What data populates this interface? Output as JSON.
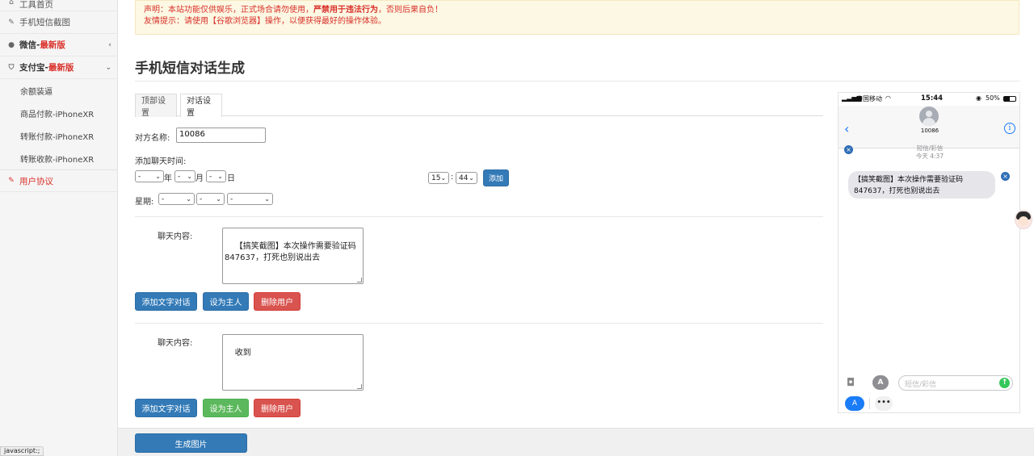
{
  "sidebar": {
    "items": [
      {
        "label": "工具首页",
        "icon": "home-icon"
      },
      {
        "label": "手机短信截图",
        "icon": "scissors-icon"
      },
      {
        "label": "微信",
        "badge": "最新版",
        "sep": " - ",
        "icon": "wechat-icon",
        "chevron": "‹"
      },
      {
        "label": "支付宝",
        "badge": "最新版",
        "sep": " - ",
        "icon": "shield-icon",
        "chevron": "⌄"
      }
    ],
    "sub_items": [
      "余额装逼",
      "商品付款-iPhoneXR",
      "转账付款-iPhoneXR",
      "转账收款-iPhoneXR"
    ],
    "agreement": "用户协议"
  },
  "status_bar_text": "javascript:;",
  "notice": {
    "line1_a": "声明：本站功能仅供娱乐，正式场合请勿使用，",
    "line1_b": "严禁用于违法行为",
    "line1_c": "，否则后果自负！",
    "line2": "友情提示：请使用【谷歌浏览器】操作，以便获得最好的操作体验。"
  },
  "page_title": "手机短信对话生成",
  "tabs": [
    "顶部设置",
    "对话设置"
  ],
  "form": {
    "contact_label": "对方名称:",
    "contact_value": "10086",
    "add_time_label": "添加聊天时间:",
    "year_val": "-",
    "year_unit": "年",
    "month_val": "-",
    "month_unit": "月",
    "day_val": "-",
    "day_unit": "日",
    "hour_val": "15",
    "colon": ":",
    "minute_val": "44",
    "add_button": "添加",
    "week_label": "星期:",
    "week1": "-",
    "week2": "-",
    "week3": "-"
  },
  "dialogs": [
    {
      "content_label": "聊天内容:",
      "content": "【搞笑截图】本次操作需要验证码\n847637，打死也别说出去",
      "add_text_button": "添加文字对话",
      "set_owner_button": "设为主人",
      "delete_user_button": "删除用户"
    },
    {
      "content_label": "聊天内容:",
      "content": "收到",
      "add_text_button": "添加文字对话",
      "set_owner_button": "设为主人",
      "delete_user_button": "删除用户"
    }
  ],
  "generate_button": "生成图片",
  "phone": {
    "carrier": "中国移动",
    "time": "15:44",
    "battery": "50%",
    "contact": "10086",
    "msg_type": "短信/彩信",
    "msg_time": "今天 4:37",
    "bubble": "【搞笑截图】本次操作需要验证码\n847637，打死也别说出去",
    "input_placeholder": "短信/彩信"
  },
  "colors": {
    "primary": "#337ab7",
    "danger": "#d9534f",
    "success": "#5cb85c",
    "notice_text": "#d9302a",
    "ios_blue": "#1a7cf6"
  }
}
